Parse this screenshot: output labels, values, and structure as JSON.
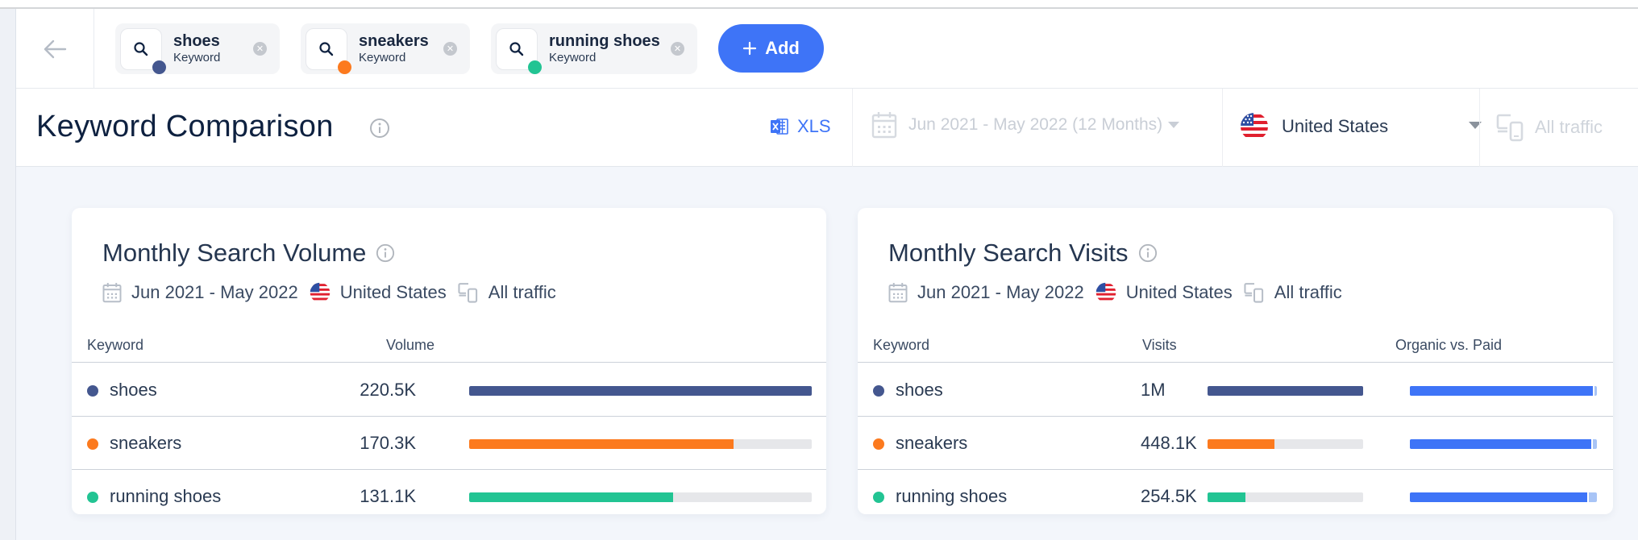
{
  "nav": {
    "back_label": "Back"
  },
  "chips": [
    {
      "keyword": "shoes",
      "type": "Keyword",
      "color": "#44578f"
    },
    {
      "keyword": "sneakers",
      "type": "Keyword",
      "color": "#fc7a1e"
    },
    {
      "keyword": "running shoes",
      "type": "Keyword",
      "color": "#22c493"
    }
  ],
  "add_button": {
    "label": "Add",
    "icon": "plus-icon"
  },
  "header": {
    "title": "Keyword Comparison",
    "export_label": "XLS",
    "date_range": "Jun 2021 - May 2022 (12 Months)",
    "country": "United States",
    "traffic": "All traffic"
  },
  "volume_card": {
    "title": "Monthly Search Volume",
    "date": "Jun 2021 - May 2022",
    "country": "United States",
    "traffic": "All traffic",
    "columns": [
      "Keyword",
      "Volume"
    ],
    "rows": [
      {
        "keyword": "shoes",
        "value": "220.5K",
        "share": 1.0,
        "color": "#44578f"
      },
      {
        "keyword": "sneakers",
        "value": "170.3K",
        "share": 0.772,
        "color": "#fc7a1e"
      },
      {
        "keyword": "running shoes",
        "value": "131.1K",
        "share": 0.595,
        "color": "#22c493"
      }
    ]
  },
  "visits_card": {
    "title": "Monthly Search Visits",
    "date": "Jun 2021 - May 2022",
    "country": "United States",
    "traffic": "All traffic",
    "columns": [
      "Keyword",
      "Visits",
      "Organic vs. Paid"
    ],
    "rows": [
      {
        "keyword": "shoes",
        "value": "1M",
        "share": 1.0,
        "organic_share": 0.985,
        "color": "#44578f"
      },
      {
        "keyword": "sneakers",
        "value": "448.1K",
        "share": 0.43,
        "organic_share": 0.98,
        "color": "#fc7a1e"
      },
      {
        "keyword": "running shoes",
        "value": "254.5K",
        "share": 0.246,
        "organic_share": 0.955,
        "color": "#22c493"
      }
    ]
  },
  "colors": {
    "accent": "#3e74f7",
    "paid": "#a8c4f6",
    "track": "#e6e7ea"
  }
}
